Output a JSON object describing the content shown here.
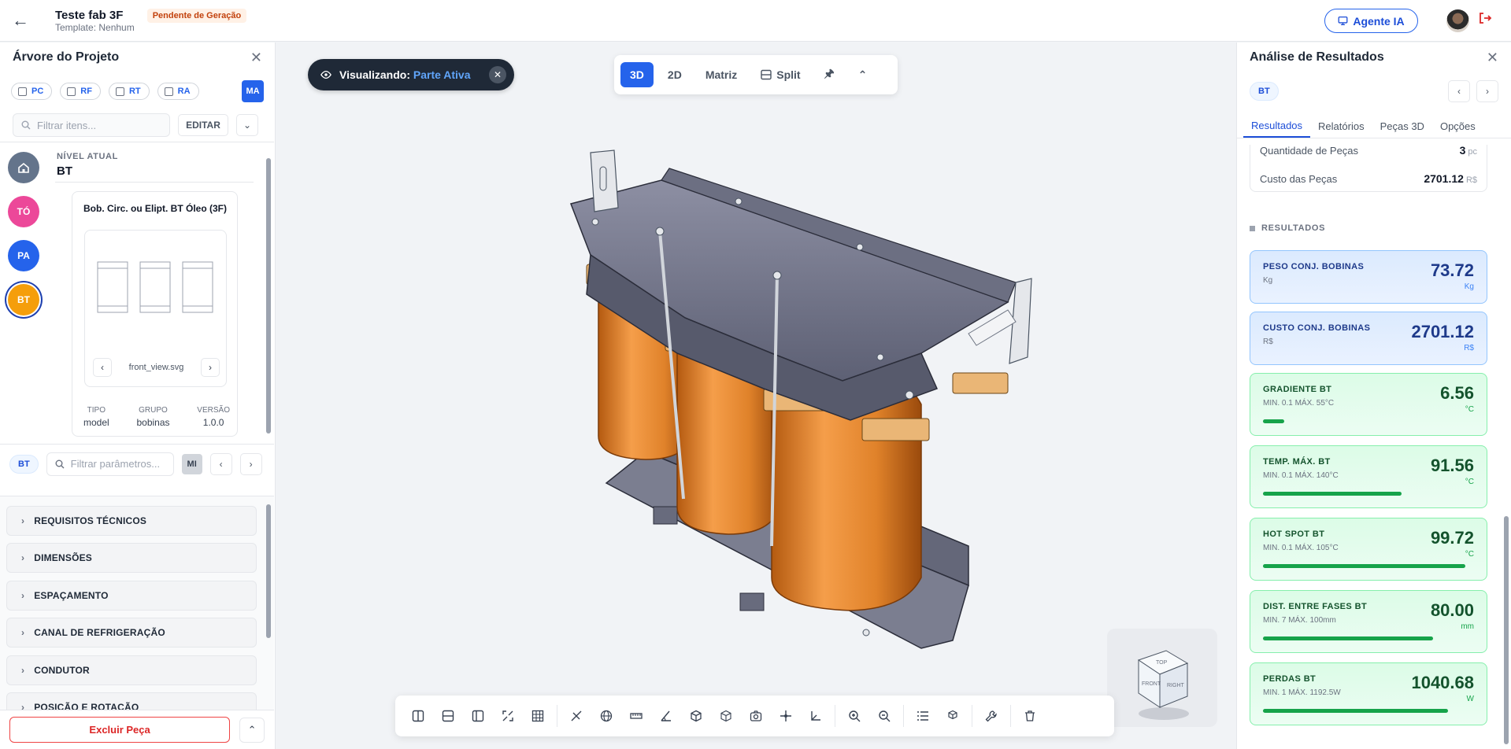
{
  "header": {
    "title": "Teste fab 3F",
    "template": "Template: Nenhum",
    "status": "Pendente de Geração",
    "agent_label": "Agente IA"
  },
  "left": {
    "title": "Árvore do Projeto",
    "chips": [
      "PC",
      "RF",
      "RT",
      "RA"
    ],
    "ma": "MA",
    "filter_placeholder": "Filtrar itens...",
    "edit_label": "EDITAR",
    "levels": [
      "TÓ",
      "PA",
      "BT"
    ],
    "current_level_label": "NÍVEL ATUAL",
    "current_level": "BT",
    "card": {
      "title": "Bob. Circ. ou Elipt. BT Óleo (3F)",
      "file": "front_view.svg",
      "meta": [
        {
          "key": "TIPO",
          "value": "model"
        },
        {
          "key": "GRUPO",
          "value": "bobinas"
        },
        {
          "key": "VERSÃO",
          "value": "1.0.0"
        }
      ]
    },
    "param_pill": "BT",
    "param_placeholder": "Filtrar parâmetros...",
    "mi": "MI",
    "sections": [
      "REQUISITOS TÉCNICOS",
      "DIMENSÕES",
      "ESPAÇAMENTO",
      "CANAL DE REFRIGERAÇÃO",
      "CONDUTOR",
      "POSIÇÃO E ROTAÇÃO"
    ],
    "delete_label": "Excluir Peça"
  },
  "viewer": {
    "viewing_prefix": "Visualizando:",
    "viewing_value": "Parte Ativa",
    "modes": [
      "3D",
      "2D",
      "Matriz",
      "Split"
    ],
    "active_mode": "3D",
    "cube_faces": [
      "TOP",
      "FRONT",
      "RIGHT"
    ]
  },
  "right": {
    "title": "Análise de Resultados",
    "pill": "BT",
    "tabs": [
      "Resultados",
      "Relatórios",
      "Peças 3D",
      "Opções"
    ],
    "summary": [
      {
        "label": "Quantidade de Peças",
        "value": "3",
        "unit": "pc"
      },
      {
        "label": "Custo das Peças",
        "value": "2701.12",
        "unit": "R$"
      }
    ],
    "results_header": "RESULTADOS",
    "results": [
      {
        "name": "PESO CONJ. BOBINAS",
        "sub": "Kg",
        "value": "73.72",
        "unit": "Kg",
        "style": "blue"
      },
      {
        "name": "CUSTO CONJ. BOBINAS",
        "sub": "R$",
        "value": "2701.12",
        "unit": "R$",
        "style": "blue"
      },
      {
        "name": "GRADIENTE BT",
        "sub": "MIN. 0.1     MÁX. 55°C",
        "value": "6.56",
        "unit": "°C",
        "style": "green",
        "progress": 0.1
      },
      {
        "name": "TEMP. MÁX. BT",
        "sub": "MIN. 0.1     MÁX. 140°C",
        "value": "91.56",
        "unit": "°C",
        "style": "green",
        "progress": 0.65
      },
      {
        "name": "HOT SPOT BT",
        "sub": "MIN. 0.1     MÁX. 105°C",
        "value": "99.72",
        "unit": "°C",
        "style": "green",
        "progress": 0.95
      },
      {
        "name": "DIST. ENTRE FASES BT",
        "sub": "MIN. 7     MÁX. 100mm",
        "value": "80.00",
        "unit": "mm",
        "style": "green",
        "progress": 0.8
      },
      {
        "name": "PERDAS BT",
        "sub": "MIN. 1     MÁX. 1192.5W",
        "value": "1040.68",
        "unit": "W",
        "style": "green",
        "progress": 0.87
      }
    ]
  }
}
